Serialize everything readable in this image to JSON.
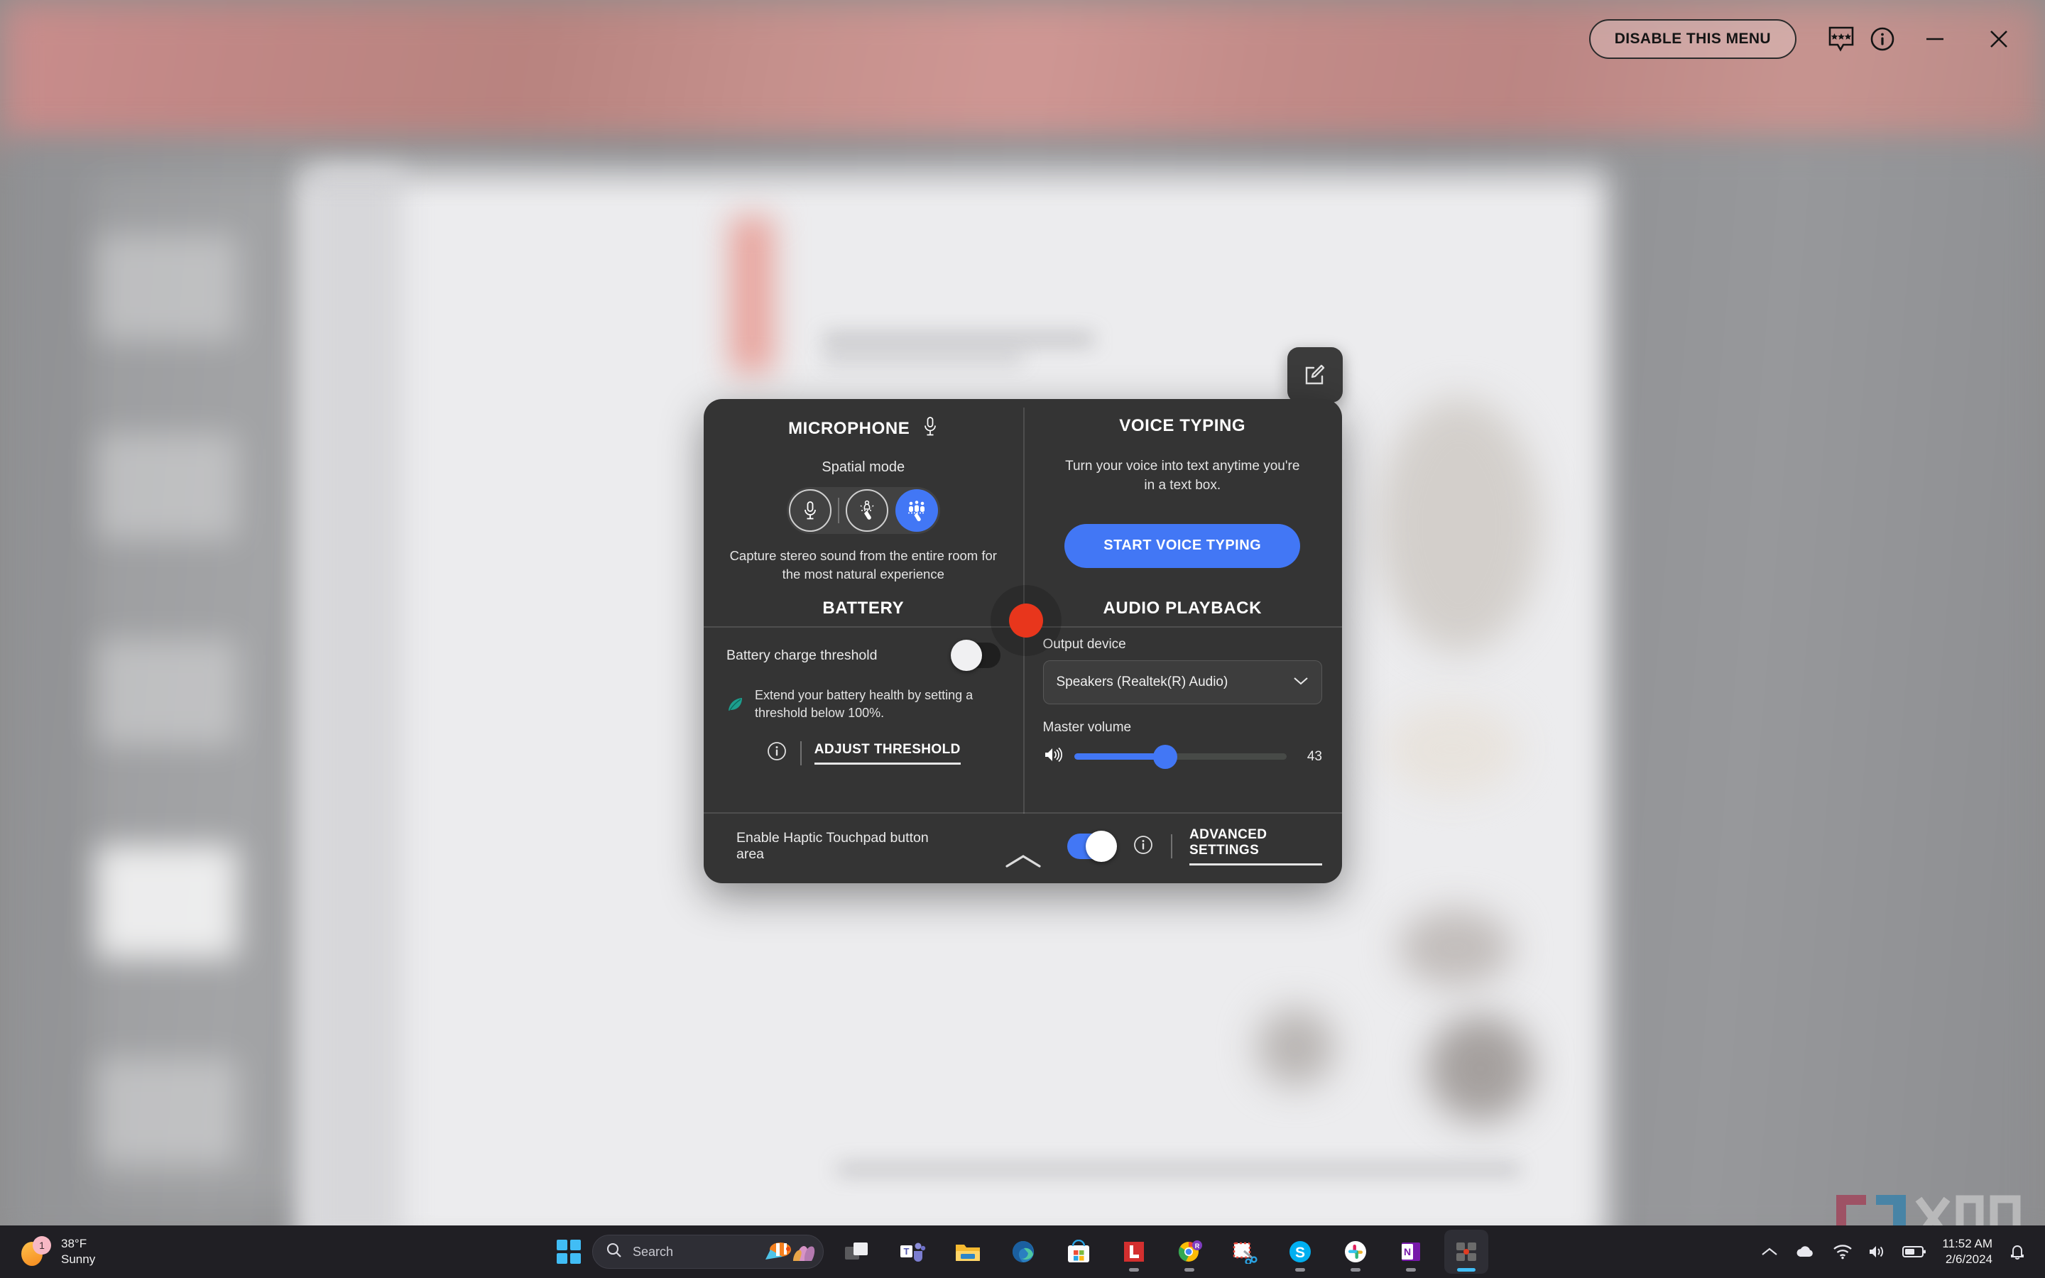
{
  "header": {
    "disable_menu_label": "DISABLE THIS MENU",
    "feedback_icon": "feedback-stars-icon",
    "info_icon": "info-circle-icon",
    "minimize_icon": "minimize-icon",
    "close_icon": "close-icon"
  },
  "fab": {
    "edit_icon": "edit-pencil-icon"
  },
  "panel": {
    "microphone": {
      "title": "MICROPHONE",
      "icon": "microphone-icon",
      "sub_label": "Spatial mode",
      "modes": [
        {
          "name": "single-voice-mode",
          "icon": "microphone-icon",
          "selected": false
        },
        {
          "name": "two-person-mode",
          "icon": "two-people-mic-icon",
          "selected": false
        },
        {
          "name": "multi-person-mode",
          "icon": "three-people-mic-icon",
          "selected": true
        }
      ],
      "description": "Capture stereo sound from the entire room for the most natural experience"
    },
    "voice_typing": {
      "title": "VOICE TYPING",
      "description": "Turn your voice into text anytime you're in a text box.",
      "button_label": "START VOICE TYPING"
    },
    "battery": {
      "title": "BATTERY",
      "threshold_label": "Battery charge threshold",
      "threshold_enabled": false,
      "tip_icon": "leaf-icon",
      "tip_text": "Extend your battery health by setting a threshold below 100%.",
      "info_icon": "info-circle-icon",
      "adjust_label": "ADJUST THRESHOLD"
    },
    "audio_playback": {
      "title": "AUDIO PLAYBACK",
      "output_label": "Output device",
      "output_value": "Speakers (Realtek(R) Audio)",
      "chevron_icon": "chevron-down-icon",
      "volume_label": "Master volume",
      "volume_icon": "speaker-volume-icon",
      "volume_value": 43,
      "volume_min": 0,
      "volume_max": 100
    },
    "footer": {
      "haptic_label": "Enable Haptic Touchpad button area",
      "haptic_enabled": true,
      "info_icon": "info-circle-icon",
      "advanced_label": "ADVANCED SETTINGS",
      "collapse_icon": "chevron-up-icon"
    }
  },
  "cursor": {
    "name": "cursor-highlight-dot",
    "color": "#e8361c"
  },
  "taskbar": {
    "weather": {
      "temperature": "38°F",
      "condition": "Sunny",
      "badge": "1"
    },
    "start_icon": "windows-start-icon",
    "search": {
      "placeholder": "Search",
      "icon": "search-icon",
      "decor_icon": "clownfish-icon"
    },
    "apps": [
      {
        "name": "task-view-icon",
        "running": false
      },
      {
        "name": "microsoft-teams-icon",
        "running": false
      },
      {
        "name": "file-explorer-icon",
        "running": false
      },
      {
        "name": "microsoft-edge-icon",
        "running": false
      },
      {
        "name": "microsoft-store-icon",
        "running": false
      },
      {
        "name": "lastpass-icon",
        "running": true
      },
      {
        "name": "google-chrome-icon",
        "running": true
      },
      {
        "name": "snipping-tool-icon",
        "running": false
      },
      {
        "name": "skype-icon",
        "running": true
      },
      {
        "name": "slack-icon",
        "running": true
      },
      {
        "name": "onenote-icon",
        "running": true
      },
      {
        "name": "mycomputer-manager-icon",
        "running": true,
        "selected": true
      }
    ],
    "tray": {
      "overflow_icon": "chevron-up-icon",
      "onedrive_icon": "onedrive-cloud-icon",
      "wifi_icon": "wifi-icon",
      "volume_icon": "speaker-icon",
      "battery_icon": "battery-icon",
      "time": "11:52 AM",
      "date": "2/6/2024",
      "notification_icon": "bell-icon"
    }
  },
  "watermark": {
    "text": "XDA"
  },
  "colors": {
    "accent": "#4277f5",
    "panel_bg": "#343434",
    "cursor_red": "#e8361c",
    "taskbar_bg": "#201f24"
  }
}
